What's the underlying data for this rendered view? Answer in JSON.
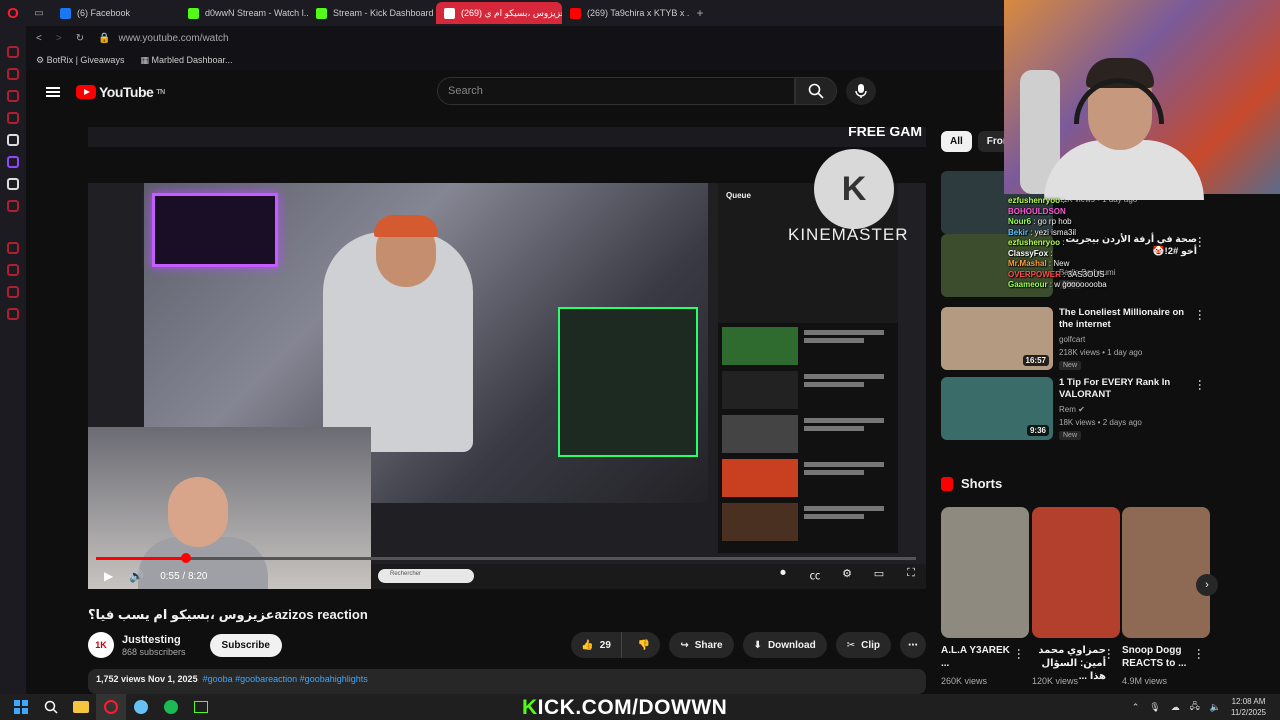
{
  "browser": {
    "tabs": [
      {
        "label": "(6) Facebook",
        "color": "#1877f2",
        "active": false
      },
      {
        "label": "d0wwN Stream - Watch l...",
        "color": "#53fc18",
        "active": false
      },
      {
        "label": "Stream - Kick Dashboard",
        "color": "#53fc18",
        "active": false
      },
      {
        "label": "(269) عزيزوس ،بسيكو ام ي...",
        "color": "#ff0000",
        "active": true
      },
      {
        "label": "(269) Ta9chira x KTYB x ...",
        "color": "#ff0000",
        "active": false
      }
    ],
    "url": "www.youtube.com/watch",
    "bookmarks": [
      "BotRix | Giveaways",
      "Marbled Dashboar..."
    ]
  },
  "youtube": {
    "logo_text": "YouTube",
    "logo_sup": "TN",
    "search_placeholder": "Search"
  },
  "player": {
    "time": "0:55 / 8:20",
    "progress": 0.11,
    "queue_label": "Queue",
    "watermark": "KINEMASTER",
    "inner_search": "Rechercher",
    "overlay_banner": "FREE GAM"
  },
  "video": {
    "title": "عزيزوس ،بسيكو ام يسب فيا؟azizos reaction",
    "channel": "Justtesting",
    "channel_avatar": "1K",
    "subscribers": "868 subscribers",
    "subscribe_label": "Subscribe",
    "likes": "29",
    "share_label": "Share",
    "download_label": "Download",
    "clip_label": "Clip",
    "views_date": "1,752 views  Nov 1, 2025",
    "tags": "#gooba #goobareaction #goobahighlights"
  },
  "right": {
    "chips": [
      "All",
      "From"
    ],
    "recommended": [
      {
        "title": "",
        "channel": "",
        "meta": "11K views • 1 day ago",
        "duration": "",
        "new": false,
        "thumb": "#2d3b3f"
      },
      {
        "title": "صحة في أرفة الأردن بيجريت أخو #2!🤡",
        "channel": "Badis Barhoumi",
        "meta": "",
        "duration": "",
        "new": true,
        "thumb": "#3c4d2d"
      },
      {
        "title": "The Loneliest Millionaire on the internet",
        "channel": "golfcart",
        "meta": "218K views • 1 day ago",
        "duration": "16:57",
        "new": true,
        "thumb": "#b59a82"
      },
      {
        "title": "1 Tip For EVERY Rank In VALORANT",
        "channel": "Rem ✔",
        "meta": "18K views • 2 days ago",
        "duration": "9:36",
        "new": true,
        "thumb": "#3a6d6a"
      }
    ],
    "shorts_label": "Shorts",
    "shorts": [
      {
        "title": "A.L.A Y3AREK ...",
        "views": "260K views",
        "thumb": "#8f8a80"
      },
      {
        "title": "حمزاوي محمد أمين: السؤال هذا ...",
        "views": "120K views",
        "thumb": "#b3402c"
      },
      {
        "title": "Snoop Dogg REACTS to ...",
        "views": "4.9M views",
        "thumb": "#8e6a54"
      }
    ]
  },
  "chat": [
    {
      "user": "ezfushenryoo",
      "msg": ":",
      "color": "#b4ff4d"
    },
    {
      "user": "BOHOULDSON",
      "msg": "",
      "color": "#ff5ad9"
    },
    {
      "user": "Nour6",
      "msg": ": go rp hob",
      "color": "#9cff57"
    },
    {
      "user": "Bekir",
      "msg": ": yezi isma3il",
      "color": "#59c2ff"
    },
    {
      "user": "ezfushenryoo",
      "msg": ":",
      "color": "#b4ff4d"
    },
    {
      "user": "ClassyFox",
      "msg": ":",
      "color": "#ffffff"
    },
    {
      "user": "Mr.Mashal",
      "msg": ": New",
      "color": "#ff9e3d"
    },
    {
      "user": "OVERPOWER",
      "msg": ": 3AS3OUS",
      "color": "#ff4d4d"
    },
    {
      "user": "Gaameour",
      "msg": ": w goooooooba",
      "color": "#9cff57"
    }
  ],
  "stream_overlay": {
    "kick_prefix": "K",
    "kick_rest": "ICK.COM/DOWWN"
  },
  "taskbar": {
    "time": "12:08 AM",
    "date": "11/2/2025"
  }
}
